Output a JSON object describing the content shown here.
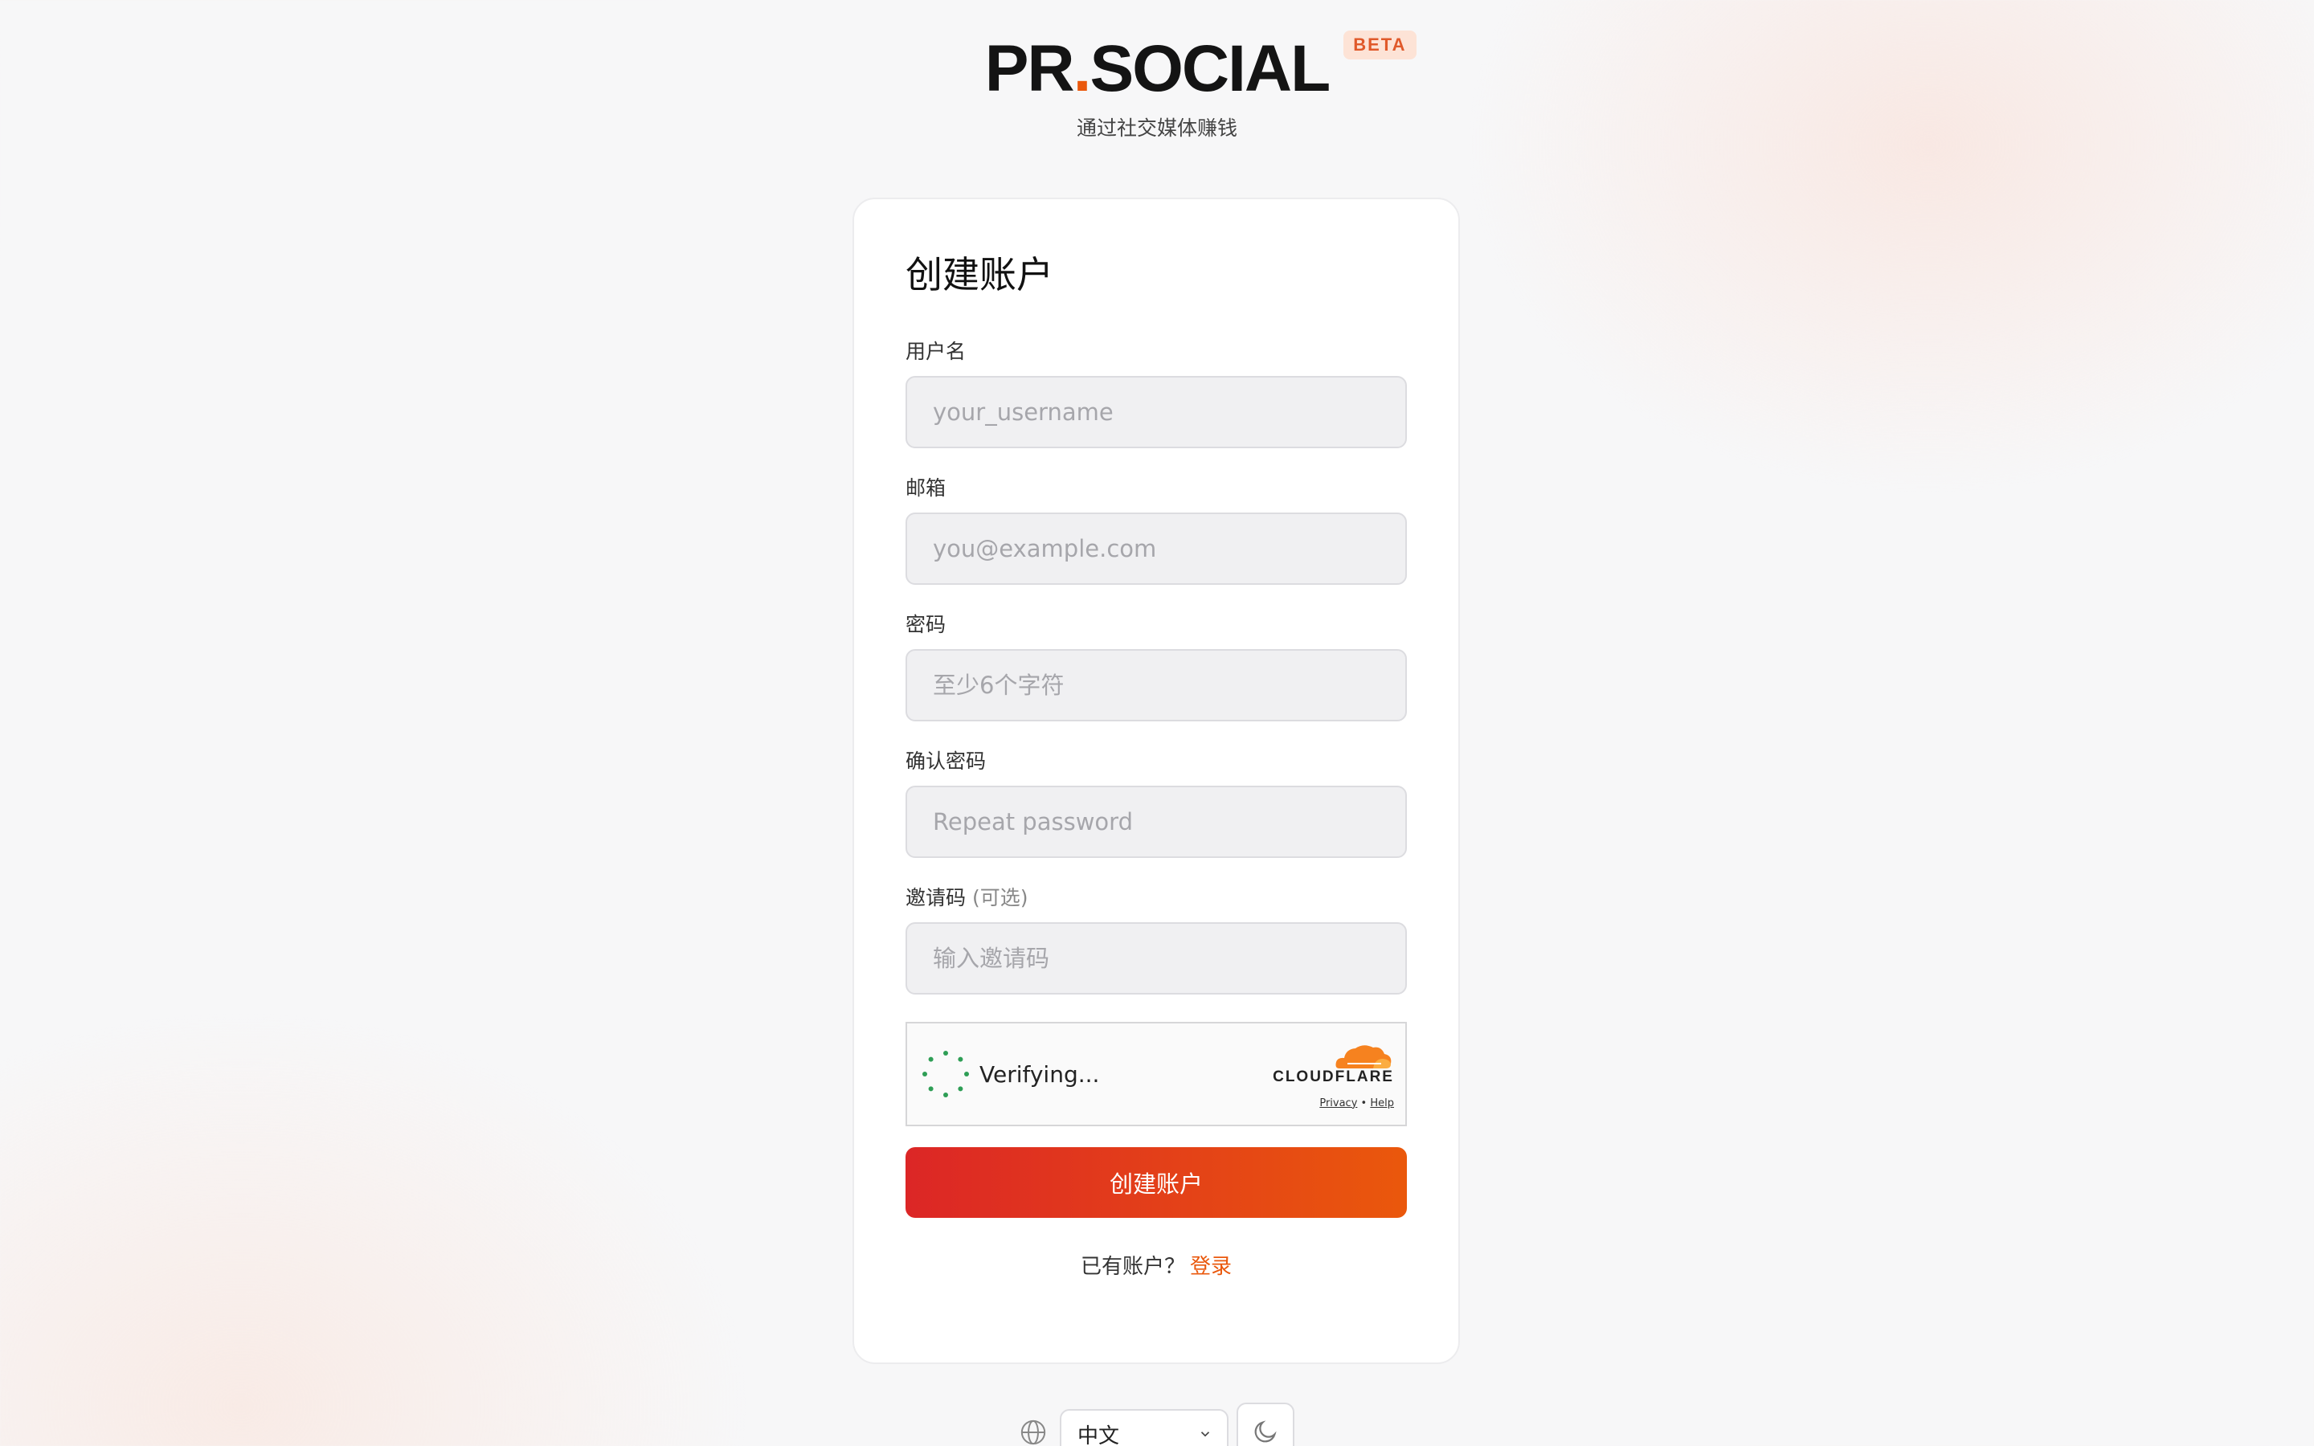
{
  "brand": {
    "name_left": "PR",
    "name_dot": ".",
    "name_right": "SOCIAL",
    "badge": "BETA",
    "tagline": "通过社交媒体赚钱"
  },
  "form": {
    "title": "创建账户",
    "fields": [
      {
        "label": "用户名",
        "placeholder": "your_username"
      },
      {
        "label": "邮箱",
        "placeholder": "you@example.com"
      },
      {
        "label": "密码",
        "placeholder": "至少6个字符"
      },
      {
        "label": "确认密码",
        "placeholder": "Repeat password"
      },
      {
        "label": "邀请码",
        "optional": "(可选)",
        "placeholder": "输入邀请码"
      }
    ],
    "captcha": {
      "status": "Verifying...",
      "provider": "CLOUDFLARE",
      "privacy": "Privacy",
      "separator": "•",
      "help": "Help"
    },
    "submit_label": "创建账户",
    "signin_prompt": "已有账户？",
    "signin_link": "登录"
  },
  "footer": {
    "language": "中文"
  },
  "colors": {
    "accent": "#ea580c",
    "accent_start": "#dc2626",
    "badge_bg": "#fde3d6"
  }
}
